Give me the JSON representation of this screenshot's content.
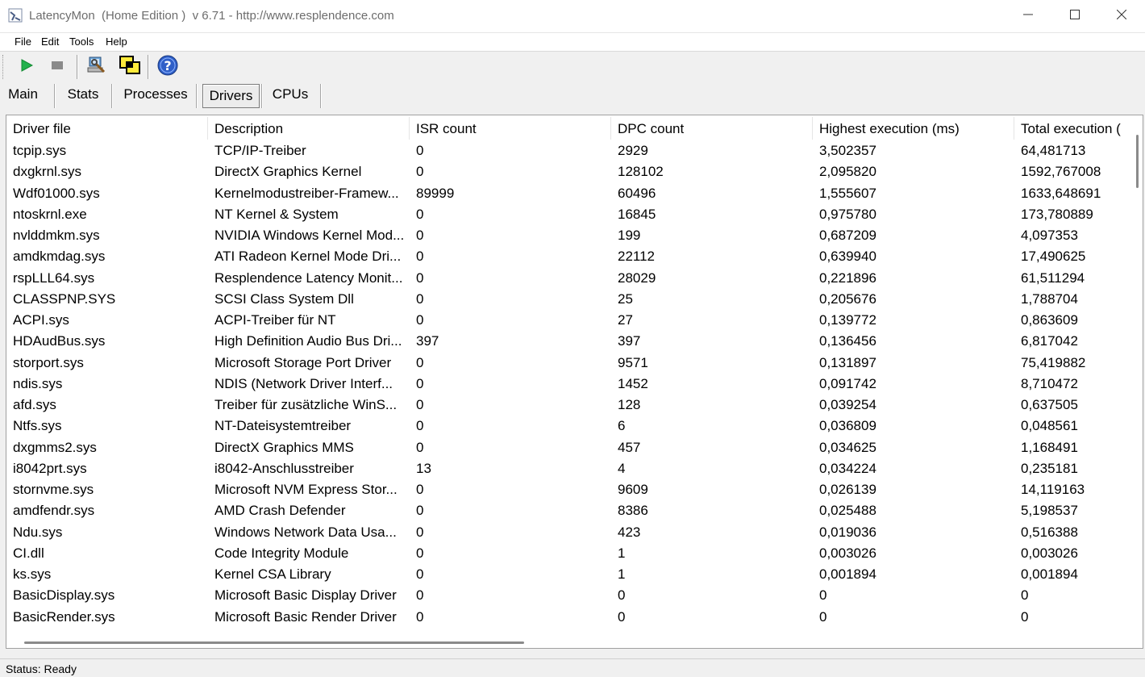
{
  "window": {
    "title": "LatencyMon  (Home Edition )  v 6.71 - http://www.resplendence.com"
  },
  "menu": [
    "File",
    "Edit",
    "Tools",
    "Help"
  ],
  "toolbar": {
    "icons": [
      "play-icon",
      "stop-icon",
      "computer-wrench-icon",
      "windows-icon",
      "help-icon"
    ]
  },
  "tabs": [
    "Main",
    "Stats",
    "Processes",
    "Drivers",
    "CPUs"
  ],
  "active_tab": "Drivers",
  "table": {
    "columns": [
      "Driver file",
      "Description",
      "ISR count",
      "DPC count",
      "Highest execution (ms)",
      "Total execution ("
    ],
    "rows": [
      [
        "tcpip.sys",
        "TCP/IP-Treiber",
        "0",
        "2929",
        "3,502357",
        "64,481713"
      ],
      [
        "dxgkrnl.sys",
        "DirectX Graphics Kernel",
        "0",
        "128102",
        "2,095820",
        "1592,767008"
      ],
      [
        "Wdf01000.sys",
        "Kernelmodustreiber-Framew...",
        "89999",
        "60496",
        "1,555607",
        "1633,648691"
      ],
      [
        "ntoskrnl.exe",
        "NT Kernel & System",
        "0",
        "16845",
        "0,975780",
        "173,780889"
      ],
      [
        "nvlddmkm.sys",
        "NVIDIA Windows Kernel Mod...",
        "0",
        "199",
        "0,687209",
        "4,097353"
      ],
      [
        "amdkmdag.sys",
        "ATI Radeon Kernel Mode Dri...",
        "0",
        "22112",
        "0,639940",
        "17,490625"
      ],
      [
        "rspLLL64.sys",
        "Resplendence Latency Monit...",
        "0",
        "28029",
        "0,221896",
        "61,511294"
      ],
      [
        "CLASSPNP.SYS",
        "SCSI Class System Dll",
        "0",
        "25",
        "0,205676",
        "1,788704"
      ],
      [
        "ACPI.sys",
        "ACPI-Treiber für NT",
        "0",
        "27",
        "0,139772",
        "0,863609"
      ],
      [
        "HDAudBus.sys",
        "High Definition Audio Bus Dri...",
        "397",
        "397",
        "0,136456",
        "6,817042"
      ],
      [
        "storport.sys",
        "Microsoft Storage Port Driver",
        "0",
        "9571",
        "0,131897",
        "75,419882"
      ],
      [
        "ndis.sys",
        "NDIS (Network Driver Interf...",
        "0",
        "1452",
        "0,091742",
        "8,710472"
      ],
      [
        "afd.sys",
        "Treiber für zusätzliche WinS...",
        "0",
        "128",
        "0,039254",
        "0,637505"
      ],
      [
        "Ntfs.sys",
        "NT-Dateisystemtreiber",
        "0",
        "6",
        "0,036809",
        "0,048561"
      ],
      [
        "dxgmms2.sys",
        "DirectX Graphics MMS",
        "0",
        "457",
        "0,034625",
        "1,168491"
      ],
      [
        "i8042prt.sys",
        "i8042-Anschlusstreiber",
        "13",
        "4",
        "0,034224",
        "0,235181"
      ],
      [
        "stornvme.sys",
        "Microsoft NVM Express Stor...",
        "0",
        "9609",
        "0,026139",
        "14,119163"
      ],
      [
        "amdfendr.sys",
        "AMD Crash Defender",
        "0",
        "8386",
        "0,025488",
        "5,198537"
      ],
      [
        "Ndu.sys",
        "Windows Network Data Usa...",
        "0",
        "423",
        "0,019036",
        "0,516388"
      ],
      [
        "CI.dll",
        "Code Integrity Module",
        "0",
        "1",
        "0,003026",
        "0,003026"
      ],
      [
        "ks.sys",
        "Kernel CSA Library",
        "0",
        "1",
        "0,001894",
        "0,001894"
      ],
      [
        "BasicDisplay.sys",
        "Microsoft Basic Display Driver",
        "0",
        "0",
        "0",
        "0"
      ],
      [
        "BasicRender.sys",
        "Microsoft Basic Render Driver",
        "0",
        "0",
        "0",
        "0"
      ]
    ]
  },
  "status": "Status: Ready",
  "colors": {
    "play": "#22b14c",
    "help": "#2f5fc8",
    "stop": "#8a8a8a"
  }
}
